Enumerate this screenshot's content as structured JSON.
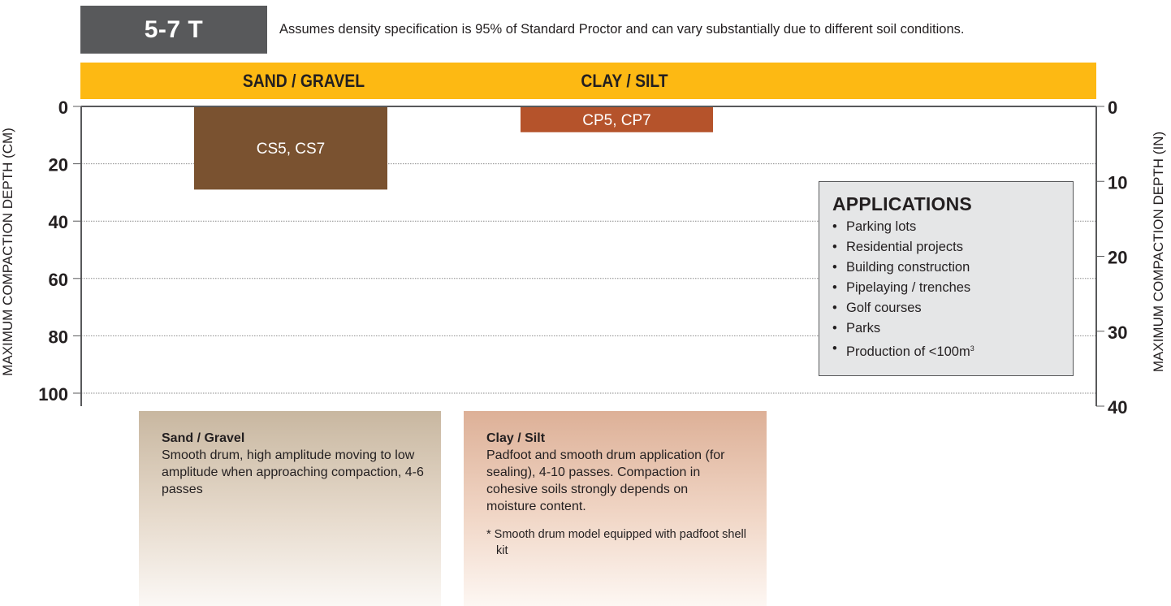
{
  "header": {
    "size_label": "5-7 T",
    "note": "Assumes density specification is 95% of Standard Proctor and can vary substantially due to different soil conditions."
  },
  "categories": {
    "sand": "SAND / GRAVEL",
    "clay": "CLAY / SILT"
  },
  "colors": {
    "header_badge": "#58595b",
    "category_bar": "#fdb913",
    "sand_bar": "#7a5230",
    "clay_bar": "#b5532b",
    "axis": "#58595b"
  },
  "chart_data": {
    "type": "bar",
    "orientation": "vertical-down",
    "categories": [
      "SAND / GRAVEL",
      "CLAY / SILT"
    ],
    "series": [
      {
        "label": "CS5, CS7",
        "category": "SAND / GRAVEL",
        "values": [
          29
        ]
      },
      {
        "label": "CP5, CP7",
        "category": "CLAY / SILT",
        "values": [
          9
        ]
      }
    ],
    "ylabel_left": "MAXIMUM COMPACTION DEPTH  (CM)",
    "ylabel_right": "MAXIMUM COMPACTION DEPTH  (IN)",
    "y_left_ticks": [
      0,
      20,
      40,
      60,
      80,
      100
    ],
    "y_right_ticks": [
      0,
      10,
      20,
      30,
      40
    ],
    "ylim_left": [
      0,
      100
    ],
    "ylim_right": [
      0,
      40
    ],
    "y_inverted": true,
    "grid": "dotted"
  },
  "applications": {
    "title": "APPLICATIONS",
    "items": [
      "Parking lots",
      "Residential projects",
      "Building construction",
      "Pipelaying / trenches",
      "Golf courses",
      "Parks",
      "Production of <100m"
    ],
    "last_item_superscript": "3"
  },
  "descriptions": {
    "sand": {
      "title": "Sand / Gravel",
      "text": "Smooth drum, high amplitude moving to low amplitude when approaching compaction, 4-6 passes"
    },
    "clay": {
      "title": "Clay / Silt",
      "text": "Padfoot and smooth drum application (for sealing), 4-10 passes. Compaction in cohesive soils strongly depends on moisture content.",
      "footnote": "* Smooth drum model equipped with padfoot shell kit"
    }
  }
}
